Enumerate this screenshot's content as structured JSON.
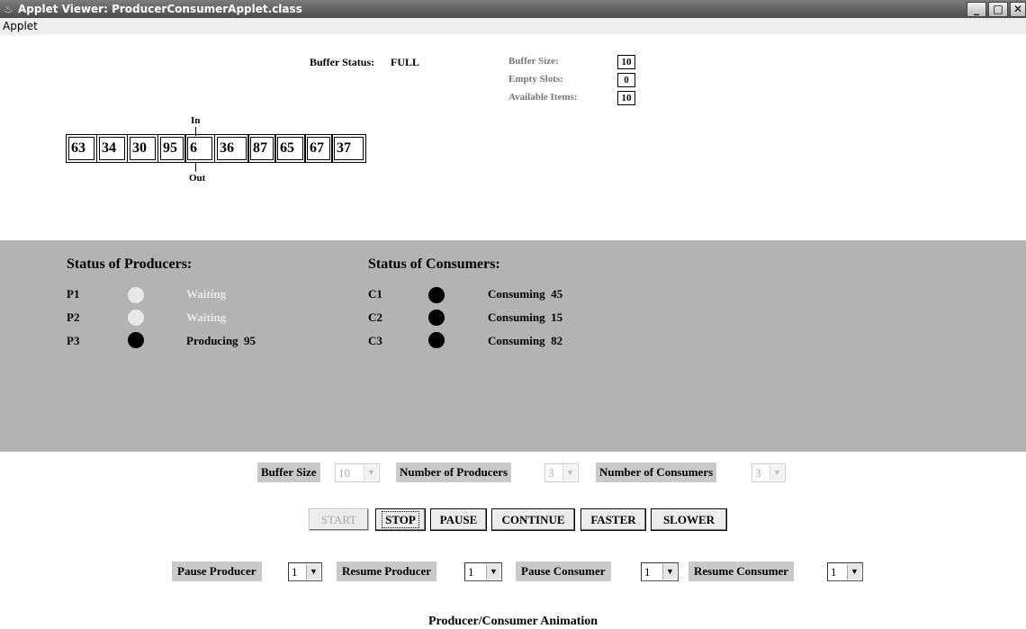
{
  "window": {
    "title": "Applet Viewer: ProducerConsumerApplet.class",
    "icon": "java-cup-icon",
    "minimize_label": "_",
    "maximize_label": "□",
    "close_label": "✕"
  },
  "menu": {
    "applet_label": "Applet"
  },
  "buffer": {
    "status_label": "Buffer Status:",
    "status_value": "FULL",
    "size_label": "Buffer Size:",
    "size_value": "10",
    "empty_label": "Empty Slots:",
    "empty_value": "0",
    "available_label": "Available Items:",
    "available_value": "10",
    "cells": [
      "63",
      "34",
      "30",
      "95",
      "6",
      "36",
      "87",
      "65",
      "67",
      "37"
    ],
    "in_label": "In",
    "out_label": "Out"
  },
  "producers": {
    "title": "Status of Producers:",
    "items": [
      {
        "name": "P1",
        "state": "Waiting",
        "indicator": "#e8e8e8"
      },
      {
        "name": "P2",
        "state": "Waiting",
        "indicator": "#e8e8e8"
      },
      {
        "name": "P3",
        "state": "Producing  95",
        "indicator": "#000000"
      }
    ]
  },
  "consumers": {
    "title": "Status of Consumers:",
    "items": [
      {
        "name": "C1",
        "state": "Consuming  45",
        "indicator": "#000000"
      },
      {
        "name": "C2",
        "state": "Consuming  15",
        "indicator": "#000000"
      },
      {
        "name": "C3",
        "state": "Consuming  82",
        "indicator": "#000000"
      }
    ]
  },
  "settings": {
    "buffer_size_label": "Buffer Size",
    "buffer_size_value": "10",
    "num_producers_label": "Number of Producers",
    "num_producers_value": "3",
    "num_consumers_label": "Number of Consumers",
    "num_consumers_value": "3"
  },
  "buttons": {
    "start": "START",
    "stop": "STOP",
    "pause": "PAUSE",
    "continue": "CONTINUE",
    "faster": "FASTER",
    "slower": "SLOWER"
  },
  "thread_controls": {
    "pause_producer_label": "Pause Producer",
    "pause_producer_value": "1",
    "resume_producer_label": "Resume Producer",
    "resume_producer_value": "1",
    "pause_consumer_label": "Pause Consumer",
    "pause_consumer_value": "1",
    "resume_consumer_label": "Resume Consumer",
    "resume_consumer_value": "1"
  },
  "footer": {
    "title": "Producer/Consumer Animation"
  },
  "colors": {
    "panel_bg": "#b3b3b3",
    "waiting_text": "#e8e8e8",
    "active_text": "#000000"
  }
}
